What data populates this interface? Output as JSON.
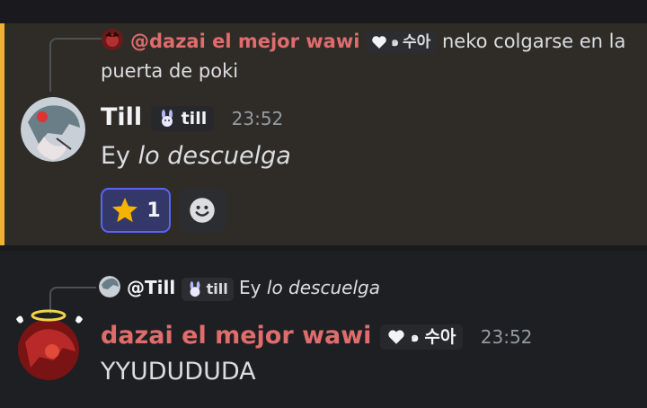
{
  "message1": {
    "reply": {
      "mention": "@dazai el mejor wawi",
      "mention_tag": "수아",
      "text_line1": "neko colgarse en la",
      "text_line2": "puerta de poki"
    },
    "author": "Till",
    "author_tag": "till",
    "timestamp": "23:52",
    "content_plain": "Ey ",
    "content_italic": "lo descuelga",
    "reaction": {
      "emoji": "star-icon",
      "count": "1"
    }
  },
  "message2": {
    "reply": {
      "mention": "@Till",
      "mention_tag": "till",
      "text_plain": "Ey ",
      "text_italic": "lo descuelga"
    },
    "author": "dazai el mejor wawi",
    "author_tag": "수아",
    "timestamp": "23:52",
    "content": "YYUDUDUDA"
  },
  "colors": {
    "highlight_bar": "#f0b232",
    "author_red": "#e06c6c",
    "reaction_border": "#5865f2",
    "timestamp": "#949ba4"
  }
}
